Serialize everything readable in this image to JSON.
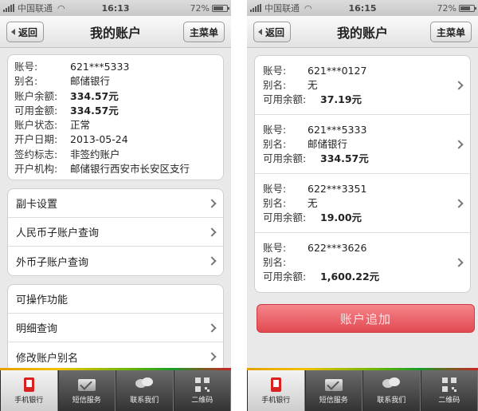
{
  "status_bar": {
    "carrier": "中国联通",
    "wifi_icon": "wifi-icon",
    "battery": "72%",
    "battery_level": 0.72,
    "time_left": "16:13",
    "time_right": "16:15"
  },
  "left": {
    "nav": {
      "back": "返回",
      "title": "我的账户",
      "menu": "主菜单"
    },
    "info": [
      {
        "label": "账号:",
        "value": "621***5333",
        "bold": false
      },
      {
        "label": "别名:",
        "value": "邮储银行",
        "bold": false
      },
      {
        "label": "账户余额:",
        "value": "334.57元",
        "bold": true
      },
      {
        "label": "可用金额:",
        "value": "334.57元",
        "bold": true
      },
      {
        "label": "账户状态:",
        "value": "正常",
        "bold": false
      },
      {
        "label": "开户日期:",
        "value": "2013-05-24",
        "bold": false
      },
      {
        "label": "签约标志:",
        "value": "非签约账户",
        "bold": false
      },
      {
        "label": "开户机构:",
        "value": "邮储银行西安市长安区支行",
        "bold": false
      }
    ],
    "menu1": [
      {
        "label": "副卡设置",
        "chevron": true
      },
      {
        "label": "人民币子账户查询",
        "chevron": true
      },
      {
        "label": "外币子账户查询",
        "chevron": true
      }
    ],
    "menu2": [
      {
        "label": "可操作功能",
        "chevron": false
      },
      {
        "label": "明细查询",
        "chevron": true
      },
      {
        "label": "修改账户别名",
        "chevron": true
      }
    ]
  },
  "right": {
    "nav": {
      "back": "返回",
      "title": "我的账户",
      "menu": "主菜单"
    },
    "labels": {
      "account": "账号:",
      "alias": "别名:",
      "available": "可用余额:"
    },
    "accounts": [
      {
        "account": "621***0127",
        "alias": "无",
        "available": "37.19元"
      },
      {
        "account": "621***5333",
        "alias": "邮储银行",
        "available": "334.57元"
      },
      {
        "account": "622***3351",
        "alias": "无",
        "available": "19.00元"
      },
      {
        "account": "622***3626",
        "alias": "",
        "available": "1,600.22元"
      }
    ],
    "add_button": "账户追加"
  },
  "tabs": [
    {
      "label": "手机银行",
      "icon": "phone-icon",
      "active": true
    },
    {
      "label": "短信服务",
      "icon": "mail-icon",
      "active": false
    },
    {
      "label": "联系我们",
      "icon": "chat-icon",
      "active": false
    },
    {
      "label": "二维码",
      "icon": "qr-code-icon",
      "active": false
    }
  ]
}
